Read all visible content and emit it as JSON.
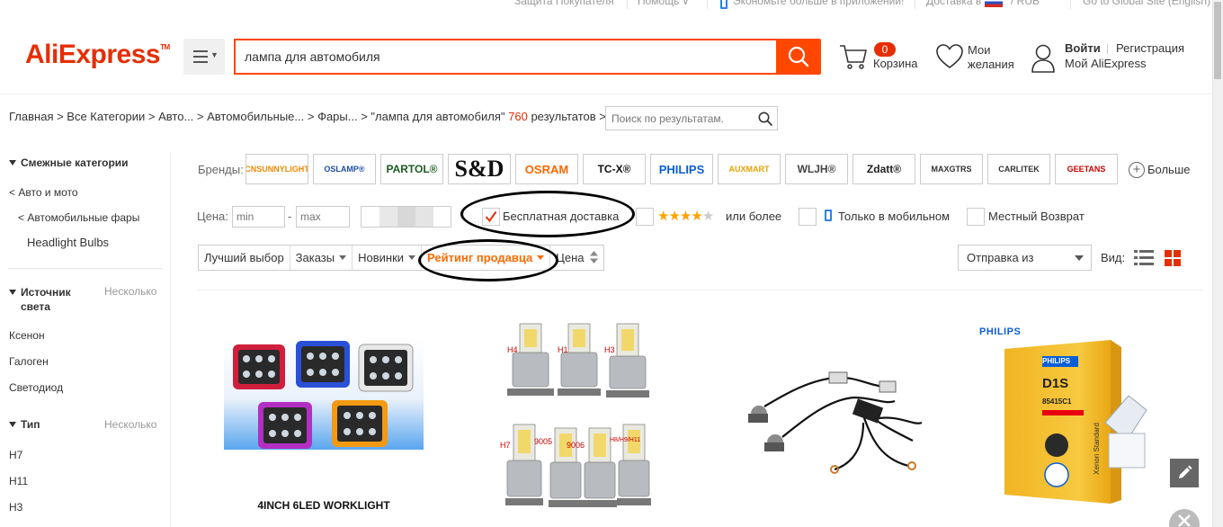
{
  "topbar": {
    "buyer_protection": "Защита Покупателя",
    "help": "Помощь",
    "app_promo": "Экономьте больше в приложении!",
    "ship_to": "Доставка в",
    "currency": "/ RUB",
    "global_site": "Go to Global Site (English)"
  },
  "header": {
    "logo": "AliExpress",
    "search": {
      "value": "лампа для автомобиля"
    },
    "cart": {
      "count": "0",
      "label": "Корзина"
    },
    "wishlist": {
      "line1": "Мои",
      "line2": "желания"
    },
    "account": {
      "signin": "Войти",
      "register": "Регистрация",
      "my_ali": "Мой AliExpress"
    }
  },
  "breadcrumb": {
    "path": "Главная > Все Категории > Авто... > Автомобильные... > Фары... > \"лампа для автомобиля\"",
    "count": "760",
    "suffix": "результатов >",
    "search_placeholder": "Поиск по результатам."
  },
  "sidebar": {
    "related": {
      "title": "Смежные категории",
      "items": [
        "< Авто и мото",
        "< Автомобильные фары",
        "Headlight Bulbs"
      ]
    },
    "light_source": {
      "title_line1": "Источник",
      "title_line2": "света",
      "many": "Несколько",
      "items": [
        "Ксенон",
        "Галоген",
        "Светодиод"
      ]
    },
    "type": {
      "title": "Тип",
      "many": "Несколько",
      "items": [
        "H7",
        "H11",
        "H3"
      ]
    }
  },
  "filters": {
    "brands_label": "Бренды:",
    "brands": [
      {
        "name": "CNSUNNYLIGHT",
        "color": "#f08a00"
      },
      {
        "name": "OSLAMP®",
        "color": "#1f4fa3"
      },
      {
        "name": "PARTOL®",
        "color": "#1a5e20"
      },
      {
        "name": "S&D",
        "color": "#111111"
      },
      {
        "name": "OSRAM",
        "color": "#ff6600"
      },
      {
        "name": "TC-X®",
        "color": "#111111"
      },
      {
        "name": "PHILIPS",
        "color": "#0b5ed7"
      },
      {
        "name": "AUXMART",
        "color": "#e8a200"
      },
      {
        "name": "WLJH®",
        "color": "#444444"
      },
      {
        "name": "Zdatt®",
        "color": "#222222"
      },
      {
        "name": "MAXGTRS",
        "color": "#333333"
      },
      {
        "name": "CARLITEK",
        "color": "#333333"
      },
      {
        "name": "GEETANS",
        "color": "#cc0000"
      }
    ],
    "more_brands": "Больше",
    "price_label": "Цена:",
    "price_min_placeholder": "min",
    "price_dash": "-",
    "price_max_placeholder": "max",
    "free_shipping": "Бесплатная доставка",
    "rating_stars": 4,
    "rating_label": "или более",
    "mobile_only": "Только в мобильном",
    "local_return": "Местный Возврат"
  },
  "sort": {
    "items": [
      {
        "label": "Лучший выбор"
      },
      {
        "label": "Заказы"
      },
      {
        "label": "Новинки"
      },
      {
        "label": "Рейтинг продавца"
      },
      {
        "label": "Цена"
      }
    ],
    "ship_from": "Отправка из",
    "view_label": "Вид:"
  },
  "products": [
    {
      "caption": "4INCH 6LED WORKLIGHT"
    },
    {
      "labels": [
        "H4",
        "H1",
        "H3",
        "H7",
        "9005",
        "9006",
        "H8/H9/H11"
      ]
    },
    {},
    {
      "brand": "PHILIPS",
      "box_brand": "PHILIPS",
      "box_title": "D1S",
      "box_code": "85415C1",
      "box_line": "Xenon Standard"
    }
  ],
  "colors": {
    "accent": "#ff4700",
    "brand_red": "#e62e04",
    "sort_active": "#ff6a00"
  }
}
